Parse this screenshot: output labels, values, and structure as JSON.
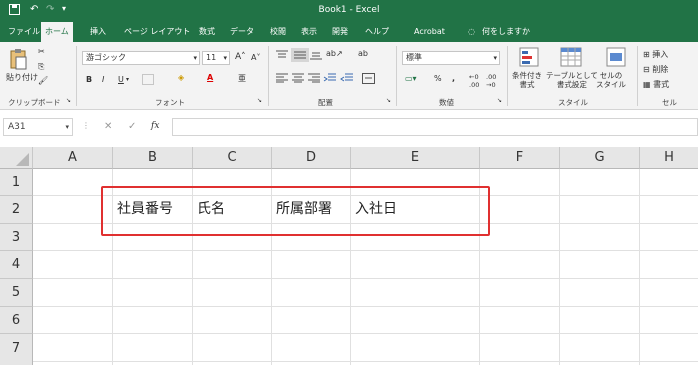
{
  "title_bar": {
    "title": "Book1  -  Excel"
  },
  "tabs": [
    {
      "label": "ファイル"
    },
    {
      "label": "ホーム"
    },
    {
      "label": "挿入"
    },
    {
      "label": "ページ レイアウト"
    },
    {
      "label": "数式"
    },
    {
      "label": "データ"
    },
    {
      "label": "校閲"
    },
    {
      "label": "表示"
    },
    {
      "label": "開発"
    },
    {
      "label": "ヘルプ"
    },
    {
      "label": "Acrobat"
    },
    {
      "label": "何をしますか"
    }
  ],
  "ribbon": {
    "clipboard": {
      "paste": "貼り付け",
      "label": "クリップボード"
    },
    "font": {
      "name": "游ゴシック",
      "size": "11",
      "label": "フォント",
      "grow": "A",
      "shrink": "A",
      "bold": "B",
      "italic": "I",
      "underline": "U"
    },
    "alignment": {
      "label": "配置"
    },
    "number": {
      "format": "標準",
      "label": "数値",
      "percent": "%",
      "comma": ","
    },
    "styles": {
      "conditional": "条件付き\n書式",
      "table": "テーブルとして\n書式設定",
      "cell": "セルの\nスタイル",
      "label": "スタイル"
    },
    "cells": {
      "insert": "挿入",
      "delete": "削除",
      "format": "書式",
      "label": "セル"
    }
  },
  "formula_bar": {
    "name_box": "A31",
    "fx": "fx",
    "formula": ""
  },
  "columns": [
    "A",
    "B",
    "C",
    "D",
    "E",
    "F",
    "G",
    "H"
  ],
  "rows": [
    "1",
    "2",
    "3",
    "4",
    "5",
    "6",
    "7"
  ],
  "cells": {
    "B2": "社員番号",
    "C2": "氏名",
    "D2": "所属部署",
    "E2": "入社日"
  },
  "accent_color": "#217346",
  "highlight_color": "#e03030"
}
